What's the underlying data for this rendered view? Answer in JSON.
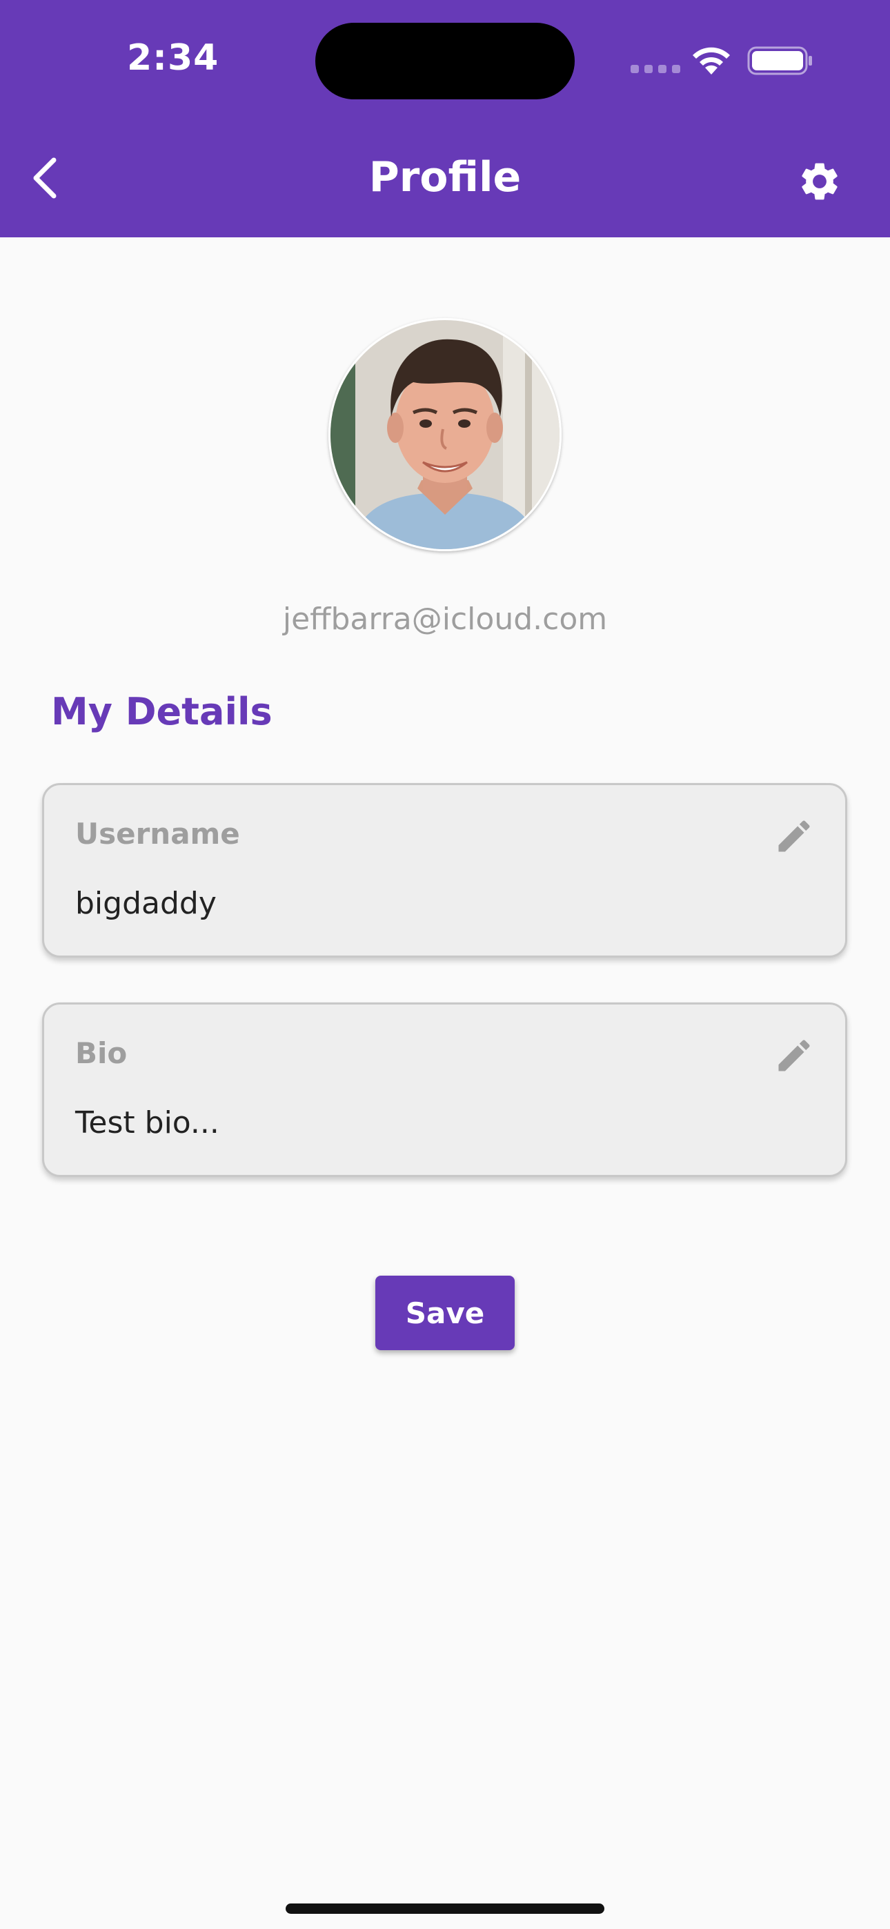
{
  "status_bar": {
    "time": "2:34"
  },
  "header": {
    "title": "Profile",
    "back_icon": "chevron-left-icon",
    "settings_icon": "gear-icon",
    "background_color": "#673ab7"
  },
  "profile": {
    "email": "jeffbarra@icloud.com"
  },
  "details": {
    "heading": "My Details",
    "fields": [
      {
        "label": "Username",
        "value": "bigdaddy",
        "icon": "pencil-edit-icon"
      },
      {
        "label": "Bio",
        "value": "Test bio...",
        "icon": "pencil-edit-icon"
      }
    ]
  },
  "actions": {
    "save_label": "Save"
  },
  "colors": {
    "accent": "#673ab7",
    "card_background": "#eeeeee",
    "muted_text": "#9e9e9e"
  }
}
